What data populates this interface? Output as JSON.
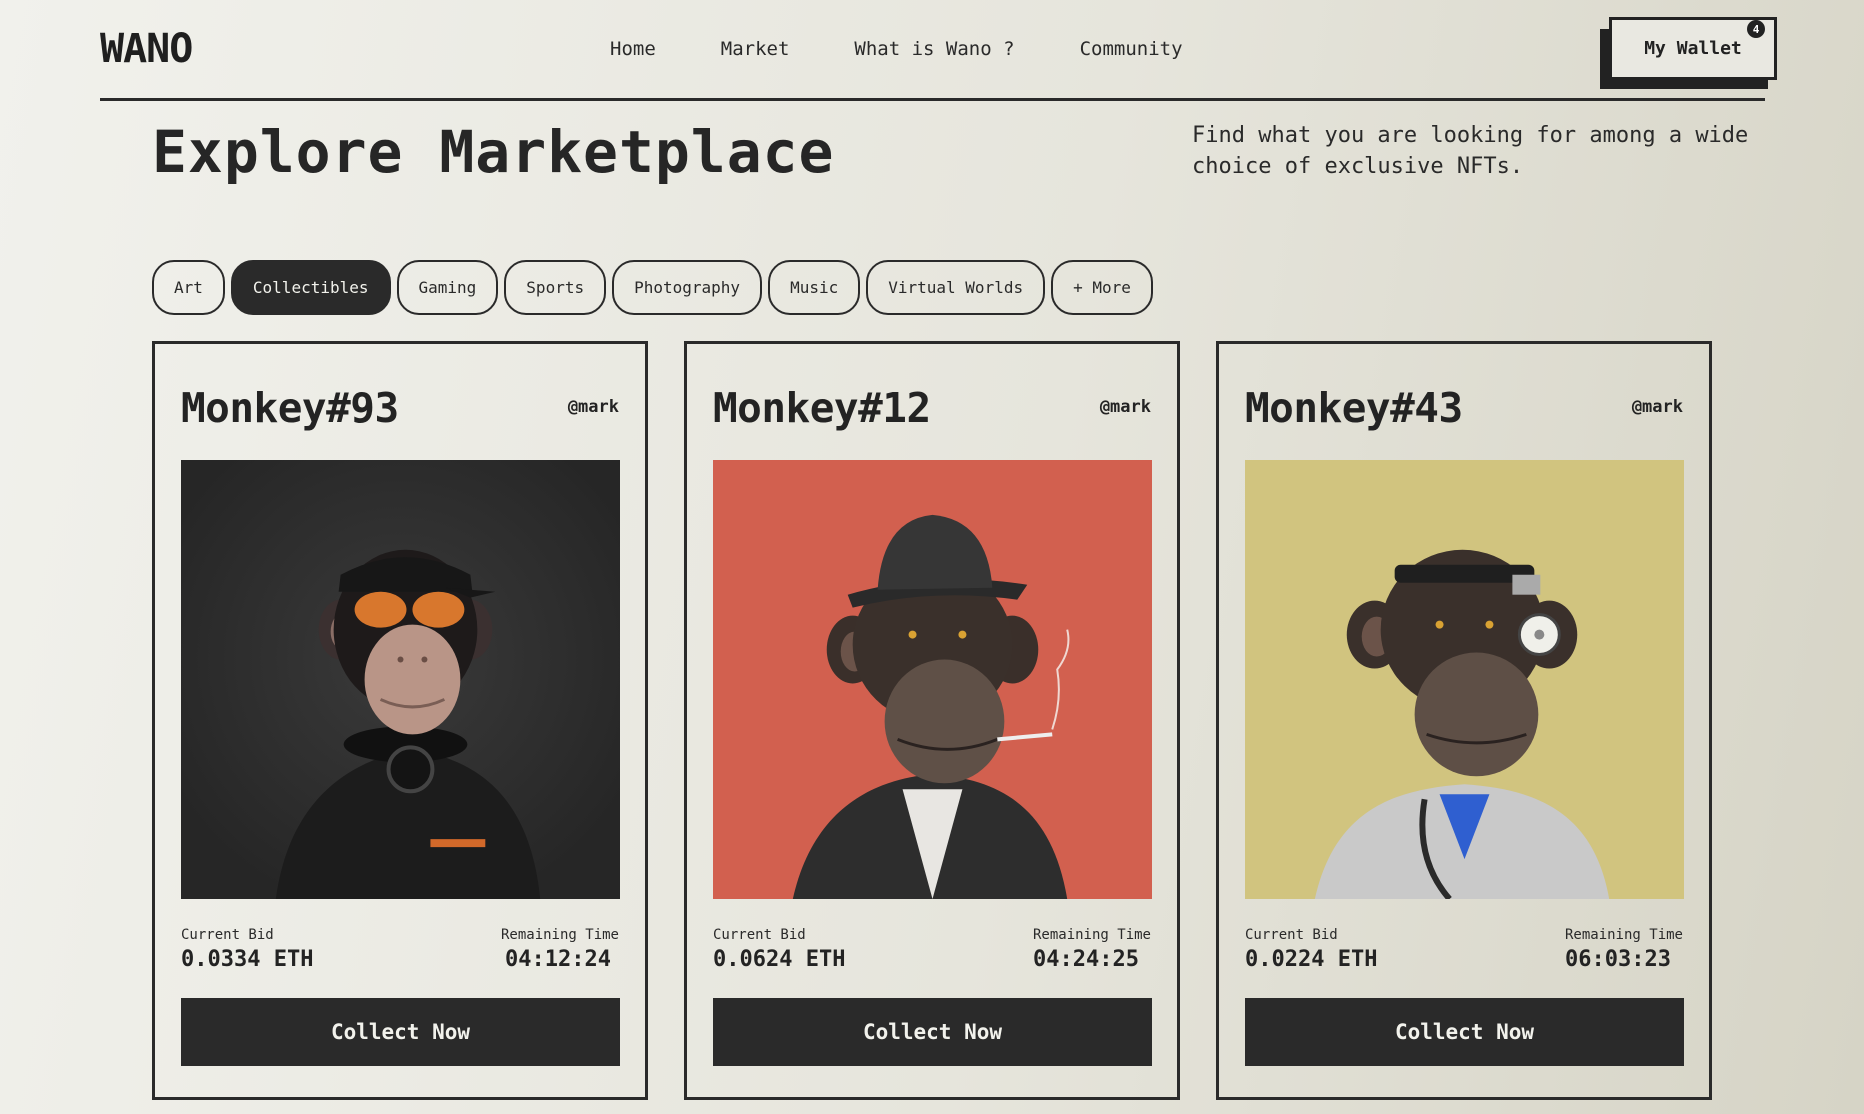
{
  "brand": {
    "logo": "WANO"
  },
  "nav": {
    "items": [
      {
        "label": "Home"
      },
      {
        "label": "Market"
      },
      {
        "label": "What is Wano ?"
      },
      {
        "label": "Community"
      }
    ]
  },
  "wallet": {
    "label": "My Wallet",
    "badge_count": "4"
  },
  "hero": {
    "title": "Explore Marketplace",
    "description": "Find what you are looking for among a wide choice of exclusive NFTs."
  },
  "categories": [
    {
      "label": "Art",
      "active": false
    },
    {
      "label": "Collectibles",
      "active": true
    },
    {
      "label": "Gaming",
      "active": false
    },
    {
      "label": "Sports",
      "active": false
    },
    {
      "label": "Photography",
      "active": false
    },
    {
      "label": "Music",
      "active": false
    },
    {
      "label": "Virtual Worlds",
      "active": false
    },
    {
      "label": "+ More",
      "active": false
    }
  ],
  "cards": [
    {
      "title": "Monkey#93",
      "owner": "@mark",
      "bid_label": "Current Bid",
      "bid_value": "0.0334 ETH",
      "time_label": "Remaining Time",
      "time_value": "04:12:24",
      "button": "Collect Now",
      "image_bg": "#2e2e2e",
      "image_icon": "ape-with-sunglasses-image"
    },
    {
      "title": "Monkey#12",
      "owner": "@mark",
      "bid_label": "Current Bid",
      "bid_value": "0.0624 ETH",
      "time_label": "Remaining Time",
      "time_value": "04:24:25",
      "button": "Collect Now",
      "image_bg": "#d2604f",
      "image_icon": "ape-with-fedora-image"
    },
    {
      "title": "Monkey#43",
      "owner": "@mark",
      "bid_label": "Current Bid",
      "bid_value": "0.0224 ETH",
      "time_label": "Remaining Time",
      "time_value": "06:03:23",
      "button": "Collect Now",
      "image_bg": "#d1c47f",
      "image_icon": "ape-doctor-image"
    }
  ],
  "colors": {
    "ink": "#2a2a2a",
    "background": "#e8e7df",
    "accent_red": "#d2604f",
    "accent_yellow": "#d1c47f"
  }
}
